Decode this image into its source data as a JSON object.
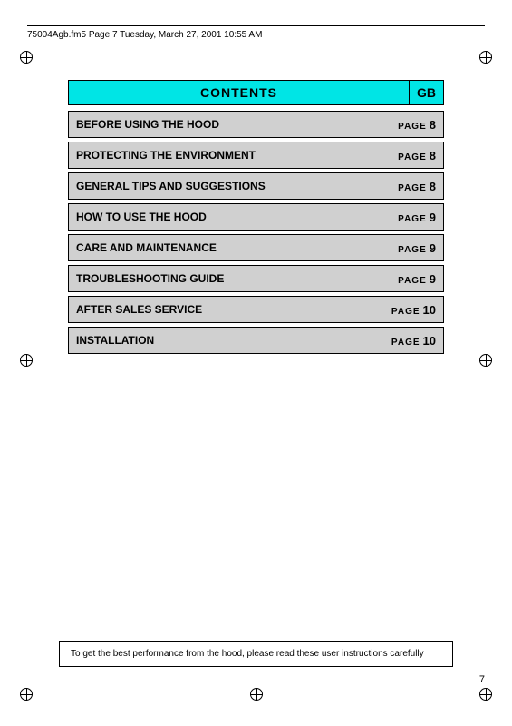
{
  "header": {
    "filename": "75004Agb.fm5  Page 7  Tuesday, March 27, 2001  10:55 AM"
  },
  "contents": {
    "title": "CONTENTS",
    "gb_label": "GB"
  },
  "toc_items": [
    {
      "title": "BEFORE USING THE HOOD",
      "page_label": "PAGE",
      "page_num": "8"
    },
    {
      "title": "PROTECTING THE ENVIRONMENT",
      "page_label": "PAGE",
      "page_num": "8"
    },
    {
      "title": "GENERAL TIPS AND SUGGESTIONS",
      "page_label": "PAGE",
      "page_num": "8"
    },
    {
      "title": "HOW TO USE THE HOOD",
      "page_label": "PAGE",
      "page_num": "9"
    },
    {
      "title": "CARE AND MAINTENANCE",
      "page_label": "PAGE",
      "page_num": "9"
    },
    {
      "title": "TROUBLESHOOTING GUIDE",
      "page_label": "PAGE",
      "page_num": "9"
    },
    {
      "title": "AFTER SALES SERVICE",
      "page_label": "PAGE",
      "page_num": "10"
    },
    {
      "title": "INSTALLATION",
      "page_label": "PAGE",
      "page_num": "10"
    }
  ],
  "bottom_note": "To get the best performance from the hood, please read these user instructions carefully",
  "page_number": "7"
}
